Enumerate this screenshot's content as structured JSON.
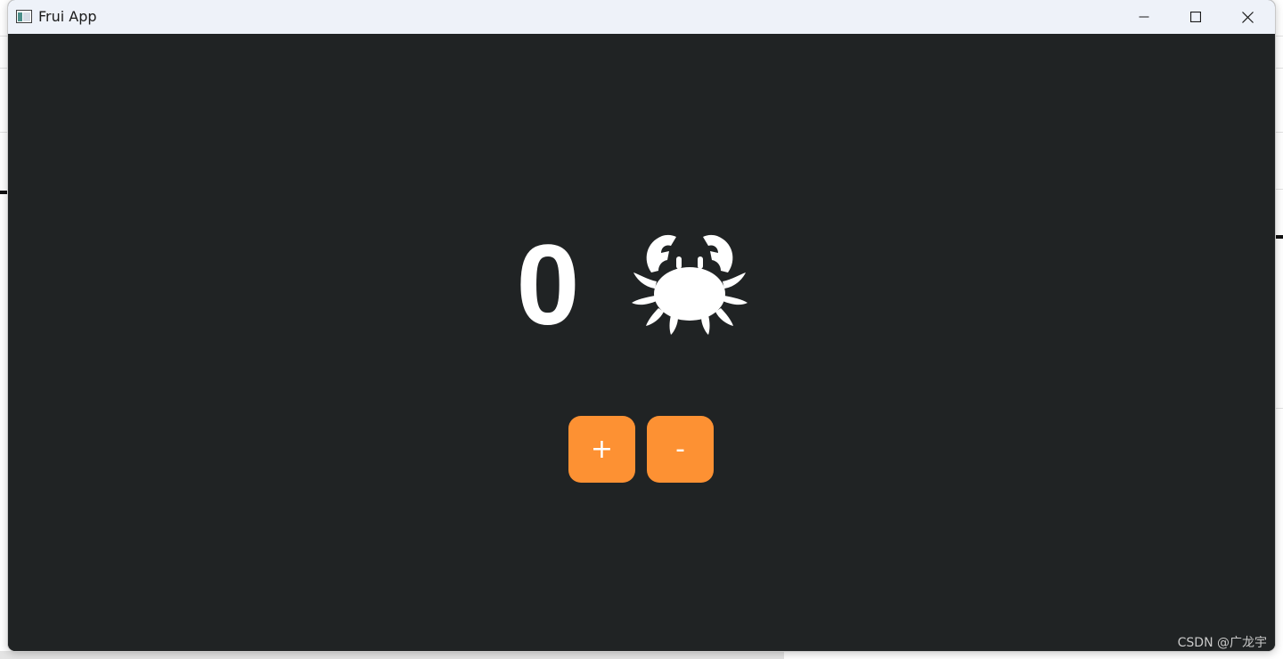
{
  "window": {
    "title": "Frui App",
    "icons": {
      "app": "app-window-icon",
      "minimize": "minimize-icon",
      "maximize": "maximize-icon",
      "close": "close-icon"
    }
  },
  "counter": {
    "value": "0",
    "mascot_icon": "crab-icon",
    "mascot_color": "#ffffff"
  },
  "actions": {
    "increment_label": "+",
    "decrement_label": "-",
    "button_color": "#fd9133"
  },
  "theme": {
    "background": "#202324",
    "titlebar": "#eef2f9"
  },
  "watermark": "CSDN @广龙宇"
}
